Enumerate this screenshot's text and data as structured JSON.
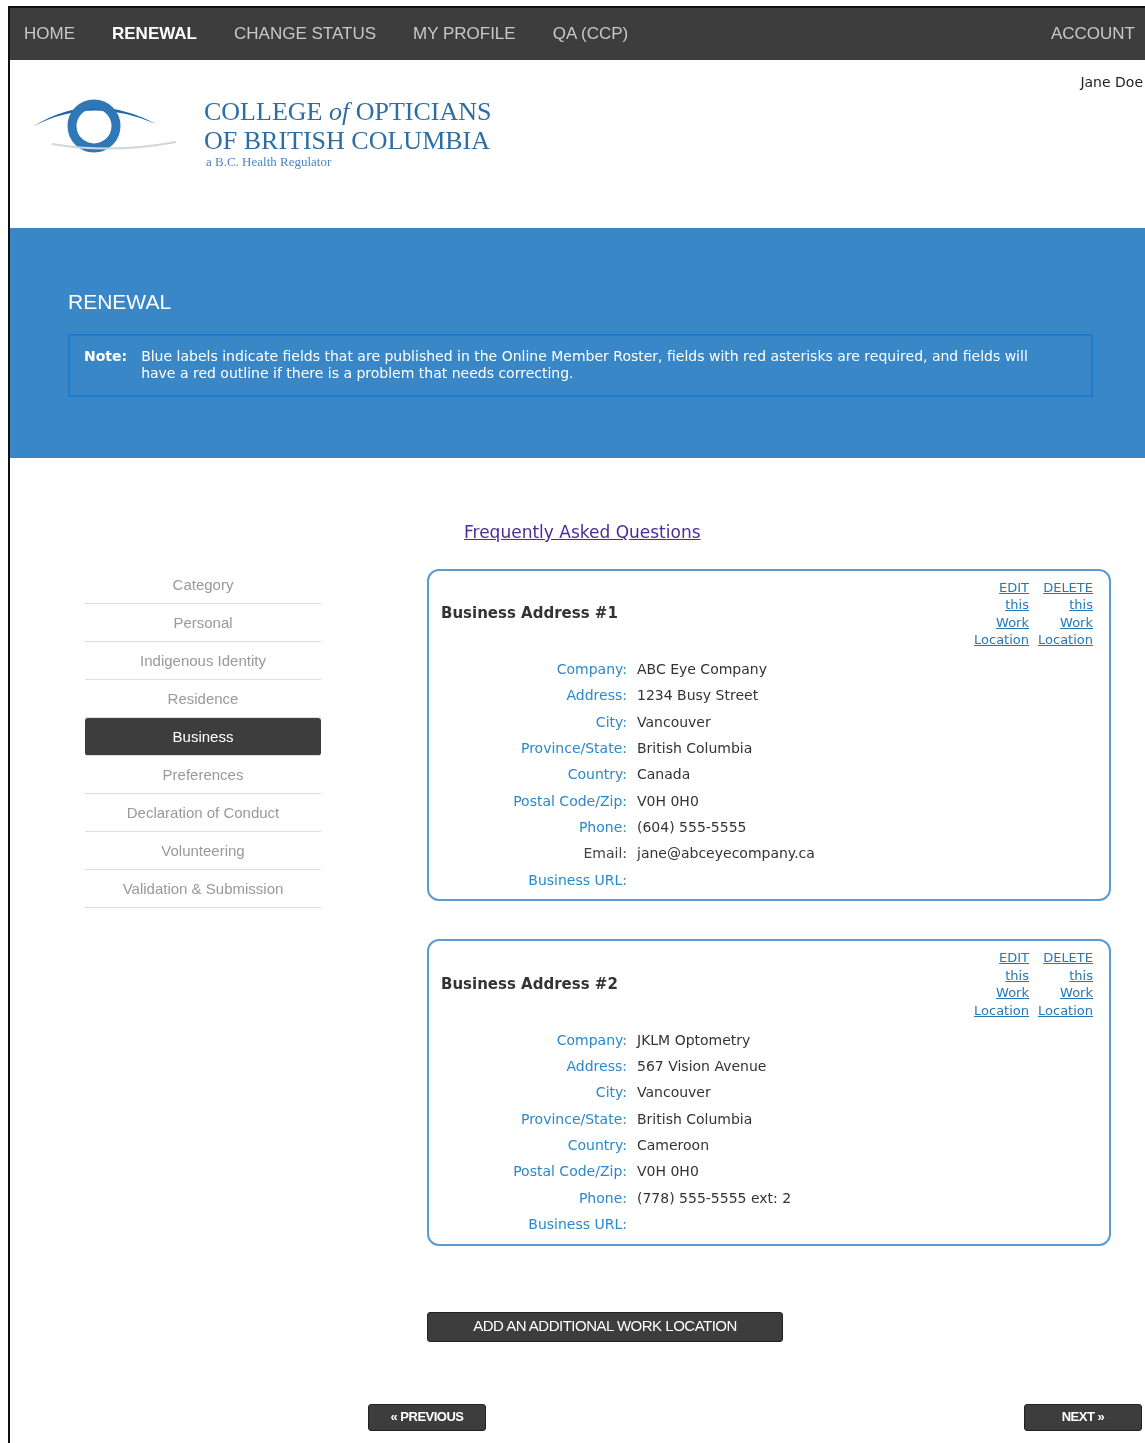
{
  "nav": {
    "items": [
      {
        "label": "HOME",
        "selected": false
      },
      {
        "label": "RENEWAL",
        "selected": true
      },
      {
        "label": "CHANGE STATUS",
        "selected": false
      },
      {
        "label": "MY PROFILE",
        "selected": false
      },
      {
        "label": "QA (CCP)",
        "selected": false
      }
    ],
    "account": "ACCOUNT"
  },
  "user_name": "Jane Doe",
  "logo": {
    "line_1": "COLLEGE *of* OPTICIANS",
    "line_2": "OF BRITISH COLUMBIA",
    "tagline": "a B.C. Health Regulator"
  },
  "banner": {
    "title": "RENEWAL",
    "note_label": "Note:",
    "note_text": "Blue labels indicate fields that are published in the Online Member Roster, fields with red asterisks are required, and fields will have a red outline if there is a problem that needs correcting."
  },
  "faq_link": "Frequently Asked Questions",
  "steps": [
    {
      "label": "Category",
      "selected": false
    },
    {
      "label": "Personal",
      "selected": false
    },
    {
      "label": "Indigenous Identity",
      "selected": false
    },
    {
      "label": "Residence",
      "selected": false
    },
    {
      "label": "Business",
      "selected": true
    },
    {
      "label": "Preferences",
      "selected": false
    },
    {
      "label": "Declaration of Conduct",
      "selected": false
    },
    {
      "label": "Volunteering",
      "selected": false
    },
    {
      "label": "Validation & Submission",
      "selected": false
    }
  ],
  "addresses": [
    {
      "title": "Business Address #1",
      "edit_link": "EDIT this Work Location",
      "delete_link": "DELETE this Work Location",
      "fields": [
        {
          "label": "Company:",
          "value": "ABC Eye Company",
          "published": true
        },
        {
          "label": "Address:",
          "value": "1234 Busy Street",
          "published": true
        },
        {
          "label": "City:",
          "value": "Vancouver",
          "published": true
        },
        {
          "label": "Province/State:",
          "value": "British Columbia",
          "published": true
        },
        {
          "label": "Country:",
          "value": "Canada",
          "published": true
        },
        {
          "label": "Postal Code/Zip:",
          "value": "V0H 0H0",
          "published": true
        },
        {
          "label": "Phone:",
          "value": "(604) 555-5555",
          "published": true
        },
        {
          "label": "Email:",
          "value": "jane@abceyecompany.ca",
          "published": false
        },
        {
          "label": "Business URL:",
          "published": true
        }
      ]
    },
    {
      "title": "Business Address #2",
      "edit_link": "EDIT this Work Location",
      "delete_link": "DELETE this Work Location",
      "fields": [
        {
          "label": "Company:",
          "value": "JKLM Optometry",
          "published": true
        },
        {
          "label": "Address:",
          "value": "567 Vision Avenue",
          "published": true
        },
        {
          "label": "City:",
          "value": "Vancouver",
          "published": true
        },
        {
          "label": "Province/State:",
          "value": "British Columbia",
          "published": true
        },
        {
          "label": "Country:",
          "value": "Cameroon",
          "published": true
        },
        {
          "label": "Postal Code/Zip:",
          "value": "V0H 0H0",
          "published": true
        },
        {
          "label": "Phone:",
          "value": "(778) 555-5555 ext: 2",
          "published": true
        },
        {
          "label": "Business URL:",
          "published": true
        }
      ]
    }
  ],
  "add_button": "ADD AN ADDITIONAL WORK LOCATION",
  "previous_button": "« PREVIOUS",
  "next_button": "NEXT »"
}
